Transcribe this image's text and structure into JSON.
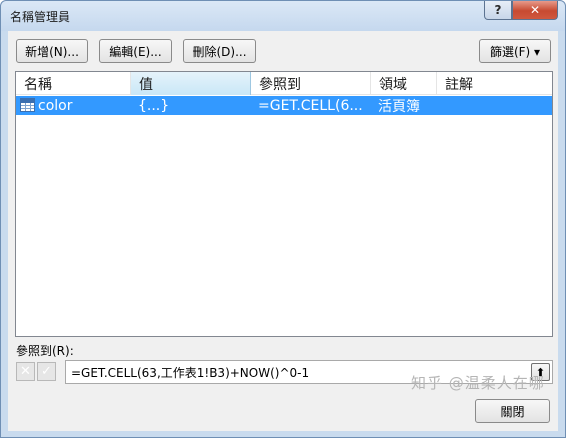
{
  "window": {
    "title": "名稱管理員",
    "help_label": "?",
    "close_label": "✕"
  },
  "toolbar": {
    "new_label": "新增(N)...",
    "edit_label": "編輯(E)...",
    "delete_label": "刪除(D)...",
    "filter_label": "篩選(F) ▾"
  },
  "table": {
    "headers": [
      "名稱",
      "值",
      "參照到",
      "領域",
      "註解"
    ],
    "rows": [
      {
        "name": "color",
        "value": "{...}",
        "refers_to": "=GET.CELL(6...",
        "scope": "活頁簿",
        "comment": ""
      }
    ]
  },
  "refers": {
    "label": "參照到(R):",
    "value": "=GET.CELL(63,工作表1!B3)+NOW()^0-1",
    "cancel_icon": "✕",
    "confirm_icon": "✓",
    "collapse_icon": "⬆"
  },
  "footer": {
    "close_label": "關閉"
  },
  "watermark": "知乎 @温柔人在哪"
}
